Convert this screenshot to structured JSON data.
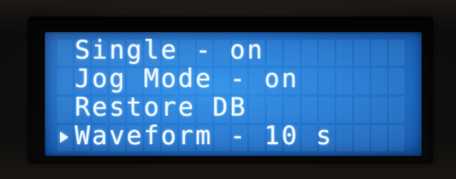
{
  "display": {
    "lines": [
      {
        "text": "Single - on",
        "selected": false
      },
      {
        "text": "Jog Mode - on",
        "selected": false
      },
      {
        "text": "Restore DB",
        "selected": false
      },
      {
        "text": "Waveform - 10 s",
        "selected": true
      }
    ],
    "columns": 20,
    "backlight_color": "#2478d2",
    "text_color": "#e9f5ff",
    "cursor_icon": "triangle-right-icon"
  }
}
